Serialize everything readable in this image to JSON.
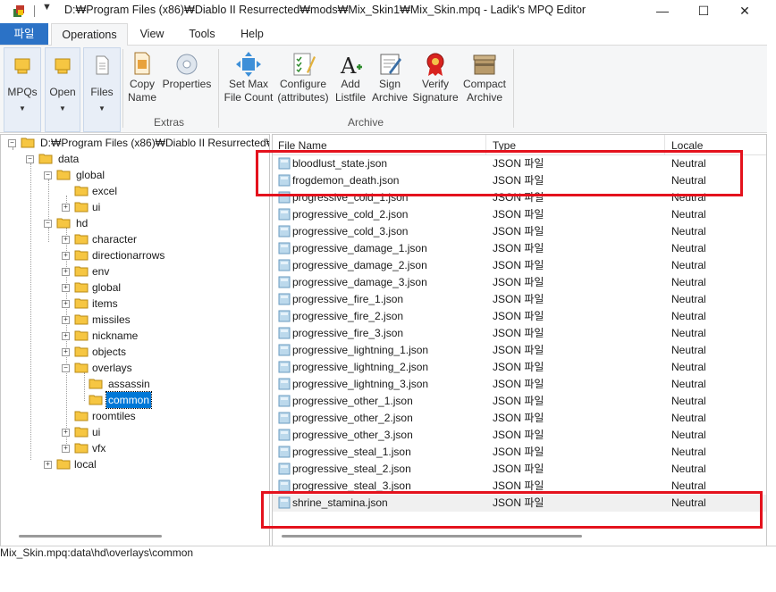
{
  "window": {
    "title": "D:₩Program Files (x86)₩Diablo II Resurrected₩mods₩Mix_Skin1₩Mix_Skin.mpq - Ladik's MPQ Editor",
    "minimize": "—",
    "maximize": "☐",
    "close": "✕"
  },
  "menu": {
    "file": "파일",
    "operations": "Operations",
    "view": "View",
    "tools": "Tools",
    "help": "Help"
  },
  "ribbon": {
    "mpqs": "MPQs",
    "open": "Open",
    "files": "Files",
    "copy_name_1": "Copy",
    "copy_name_2": "Name",
    "properties": "Properties",
    "extras": "Extras",
    "set_max_1": "Set Max",
    "set_max_2": "File Count",
    "configure_1": "Configure",
    "configure_2": "(attributes)",
    "add_1": "Add",
    "add_2": "Listfile",
    "sign_1": "Sign",
    "sign_2": "Archive",
    "verify_1": "Verify",
    "verify_2": "Signature",
    "compact_1": "Compact",
    "compact_2": "Archive",
    "archive": "Archive"
  },
  "tree": {
    "root": "D:₩Program Files (x86)₩Diablo II Resurrected₩",
    "data": "data",
    "global": "global",
    "excel": "excel",
    "ui": "ui",
    "hd": "hd",
    "character": "character",
    "directionarrows": "directionarrows",
    "env": "env",
    "hd_global": "global",
    "items": "items",
    "missiles": "missiles",
    "nickname": "nickname",
    "objects": "objects",
    "overlays": "overlays",
    "assassin": "assassin",
    "common": "common",
    "roomtiles": "roomtiles",
    "hd_ui": "ui",
    "vfx": "vfx",
    "local": "local"
  },
  "list": {
    "headers": {
      "name": "File Name",
      "type": "Type",
      "locale": "Locale"
    },
    "rows": [
      {
        "name": "bloodlust_state.json",
        "type": "JSON 파일",
        "locale": "Neutral"
      },
      {
        "name": "frogdemon_death.json",
        "type": "JSON 파일",
        "locale": "Neutral"
      },
      {
        "name": "progressive_cold_1.json",
        "type": "JSON 파일",
        "locale": "Neutral"
      },
      {
        "name": "progressive_cold_2.json",
        "type": "JSON 파일",
        "locale": "Neutral"
      },
      {
        "name": "progressive_cold_3.json",
        "type": "JSON 파일",
        "locale": "Neutral"
      },
      {
        "name": "progressive_damage_1.json",
        "type": "JSON 파일",
        "locale": "Neutral"
      },
      {
        "name": "progressive_damage_2.json",
        "type": "JSON 파일",
        "locale": "Neutral"
      },
      {
        "name": "progressive_damage_3.json",
        "type": "JSON 파일",
        "locale": "Neutral"
      },
      {
        "name": "progressive_fire_1.json",
        "type": "JSON 파일",
        "locale": "Neutral"
      },
      {
        "name": "progressive_fire_2.json",
        "type": "JSON 파일",
        "locale": "Neutral"
      },
      {
        "name": "progressive_fire_3.json",
        "type": "JSON 파일",
        "locale": "Neutral"
      },
      {
        "name": "progressive_lightning_1.json",
        "type": "JSON 파일",
        "locale": "Neutral"
      },
      {
        "name": "progressive_lightning_2.json",
        "type": "JSON 파일",
        "locale": "Neutral"
      },
      {
        "name": "progressive_lightning_3.json",
        "type": "JSON 파일",
        "locale": "Neutral"
      },
      {
        "name": "progressive_other_1.json",
        "type": "JSON 파일",
        "locale": "Neutral"
      },
      {
        "name": "progressive_other_2.json",
        "type": "JSON 파일",
        "locale": "Neutral"
      },
      {
        "name": "progressive_other_3.json",
        "type": "JSON 파일",
        "locale": "Neutral"
      },
      {
        "name": "progressive_steal_1.json",
        "type": "JSON 파일",
        "locale": "Neutral"
      },
      {
        "name": "progressive_steal_2.json",
        "type": "JSON 파일",
        "locale": "Neutral"
      },
      {
        "name": "progressive_steal_3.json",
        "type": "JSON 파일",
        "locale": "Neutral"
      },
      {
        "name": "shrine_stamina.json",
        "type": "JSON 파일",
        "locale": "Neutral"
      }
    ]
  },
  "status": "Mix_Skin.mpq:data\\hd\\overlays\\common",
  "colors": {
    "accent": "#2b72c6",
    "selection": "#0078d7",
    "annotation": "#e4121d"
  }
}
